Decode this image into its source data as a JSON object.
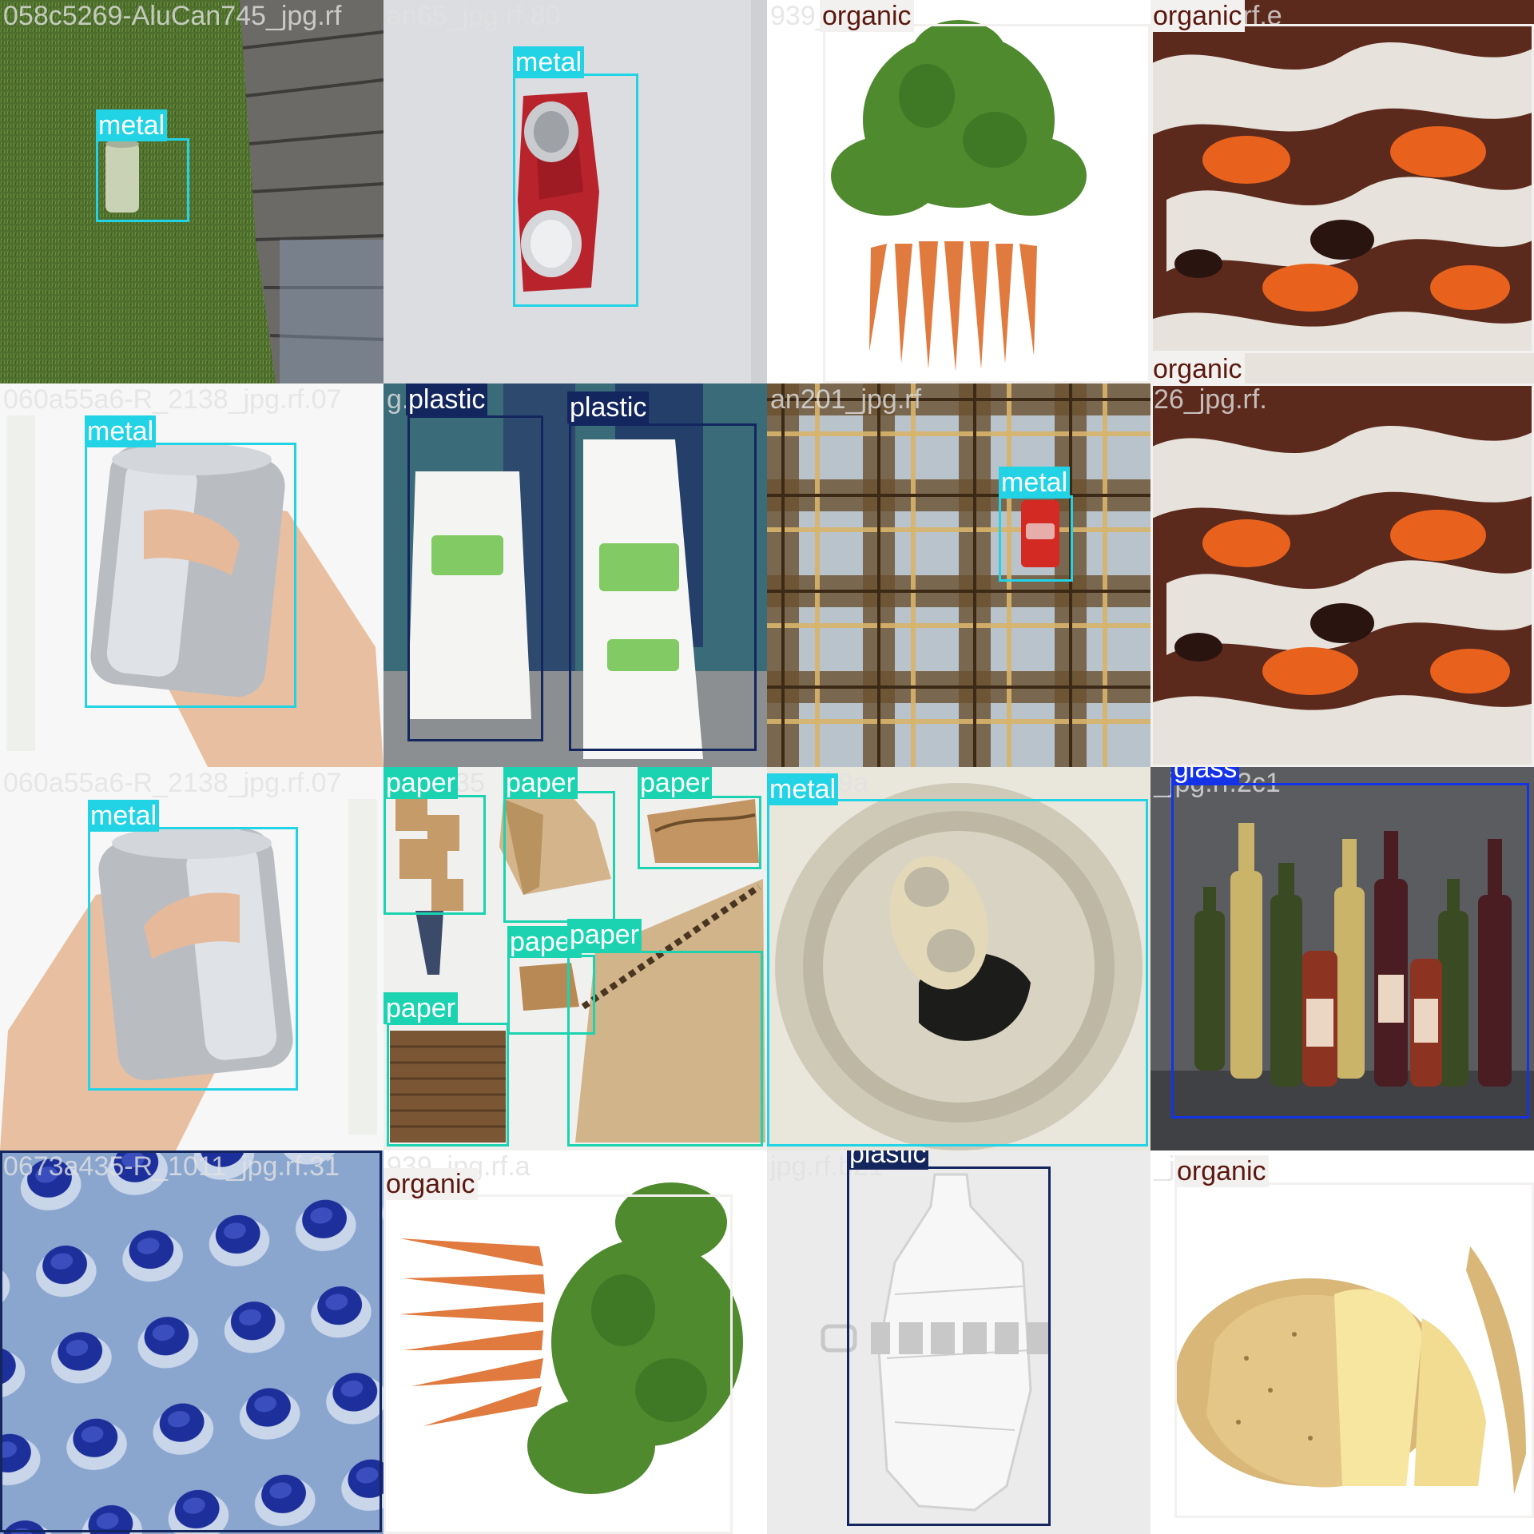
{
  "classes": [
    "metal",
    "paper",
    "plastic",
    "glass",
    "organic"
  ],
  "colors": {
    "metal": "#22d3e6",
    "paper": "#1bd3b0",
    "plastic": "#13265e",
    "glass": "#1433e6",
    "organic": "#f3f1ef",
    "organic_text": "#5a1810"
  },
  "tiles": [
    {
      "filename": "058c5269-AluCan745_jpg.rf",
      "scene": "aluminium can lying on artificial grass beside wooden decking",
      "labels": [
        "metal"
      ]
    },
    {
      "filename": "an65_jpg.rf.80",
      "scene": "crushed red aluminium can on grey surface",
      "labels": [
        "metal"
      ]
    },
    {
      "filename": "939_jpg.rf.a",
      "scene": "bunch of carrots with green tops on white",
      "labels": [
        "organic"
      ]
    },
    {
      "filename": "26_jpg.rf.e",
      "scene": "close-up of orange and white fish pieces",
      "labels": [
        "organic",
        "organic"
      ]
    },
    {
      "filename": "060a55a6-R_2138_jpg.rf.07",
      "scene": "hand holding a plain silver can",
      "labels": [
        "metal"
      ]
    },
    {
      "filename": "g.rf.55",
      "scene": "two white ASDA plastic shopping bags carried by a person",
      "labels": [
        "plastic",
        "plastic"
      ]
    },
    {
      "filename": "an201_jpg.rf",
      "scene": "small red can on a tartan blanket",
      "labels": [
        "metal"
      ]
    },
    {
      "filename": "26_jpg.rf.",
      "scene": "close-up of orange and white fish pieces",
      "labels": [
        "organic"
      ]
    },
    {
      "filename": "060a55a6-R_2138_jpg.rf.07",
      "scene": "hand holding a plain silver can",
      "labels": [
        "metal"
      ]
    },
    {
      "filename": "jpg.rf.35",
      "scene": "collage of cardboard boxes and corrugated cardboard",
      "labels": [
        "paper",
        "paper",
        "paper",
        "paper",
        "paper",
        "paper"
      ]
    },
    {
      "filename": "jpg.rf.9a",
      "scene": "close-up of an opened can top with pull tab",
      "labels": [
        "metal"
      ]
    },
    {
      "filename": "_jpg.rf.2c1",
      "scene": "row of glass wine and beer bottles",
      "labels": [
        "glass"
      ]
    },
    {
      "filename": "0673a435-R_1011_jpg.rf.31",
      "scene": "rows of plastic water bottles with blue caps",
      "labels": [
        "plastic"
      ]
    },
    {
      "filename": "939_jpg.rf.a",
      "scene": "bunch of carrots with green tops lying sideways",
      "labels": [
        "organic"
      ]
    },
    {
      "filename": "jpg.rf.b21",
      "scene": "crushed clear plastic bottle with 123RF watermark",
      "labels": [
        "plastic"
      ]
    },
    {
      "filename": "_jpg.rf.ee",
      "scene": "half-peeled potato with peel",
      "labels": [
        "organic"
      ]
    }
  ]
}
